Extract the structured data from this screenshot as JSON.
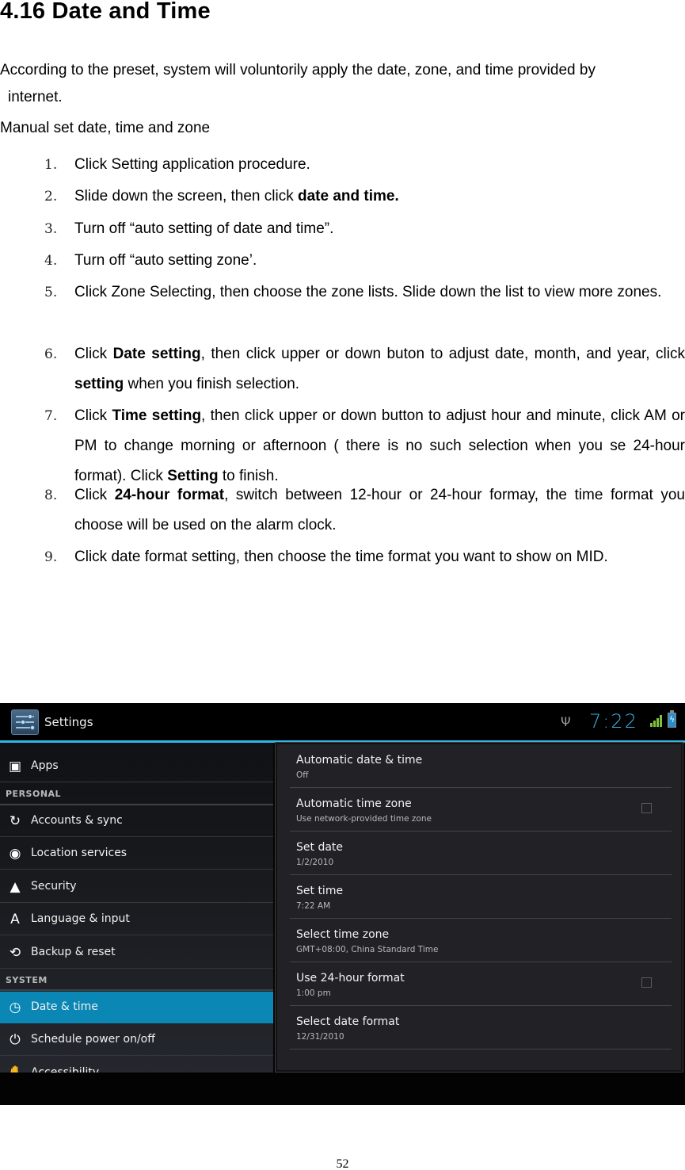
{
  "document": {
    "heading": "4.16 Date and Time",
    "intro_line1": "According to the preset, system will voluntorily apply the date, zone, and time provided by",
    "intro_line2": "internet.",
    "subheading": "Manual set date, time and zone",
    "steps": [
      {
        "num": "1.",
        "parts": [
          {
            "text": "Click Setting application procedure."
          }
        ]
      },
      {
        "num": "2.",
        "parts": [
          {
            "text": "Slide down the screen, then click "
          },
          {
            "text": "date and time.",
            "bold": true
          }
        ]
      },
      {
        "num": "3.",
        "parts": [
          {
            "text": "Turn off “auto setting of date and time”."
          }
        ]
      },
      {
        "num": "4.",
        "parts": [
          {
            "text": "Turn off “auto setting zone’."
          }
        ]
      },
      {
        "num": "5.",
        "parts": [
          {
            "text": "Click Zone Selecting, then choose the zone lists. Slide down the list to view more zones."
          }
        ]
      },
      {
        "num": "6.",
        "parts": [
          {
            "text": "Click "
          },
          {
            "text": "Date setting",
            "bold": true
          },
          {
            "text": ", then click upper or down buton to adjust date, month, and year, click "
          },
          {
            "text": "setting",
            "bold": true
          },
          {
            "text": " when you finish selection."
          }
        ]
      },
      {
        "num": "7.",
        "parts": [
          {
            "text": "Click "
          },
          {
            "text": "Time setting",
            "bold": true
          },
          {
            "text": ", then click upper or down button to adjust hour and minute, click AM or PM to change morning or afternoon ( there is no such selection when you se 24-hour format). Click "
          },
          {
            "text": "Setting",
            "bold": true
          },
          {
            "text": " to finish."
          }
        ]
      },
      {
        "num": "8.",
        "parts": [
          {
            "text": "Click "
          },
          {
            "text": "24-hour format",
            "bold": true
          },
          {
            "text": ", switch between 12-hour or 24-hour formay, the time format you choose will be used on the alarm clock."
          }
        ]
      },
      {
        "num": "9.",
        "parts": [
          {
            "text": "Click date format setting, then choose the time format you want to show on MID."
          }
        ]
      }
    ],
    "page_number": "52"
  },
  "screenshot": {
    "action_bar": {
      "app_icon": "settings-sliders-icon",
      "title": "Settings",
      "status": {
        "usb_icon": "Ψ",
        "clock": "7:22",
        "signal_icon": "signal-bars-icon",
        "battery_icon": "battery-charging-icon",
        "battery_glyph": "ϟ"
      }
    },
    "colors": {
      "accent": "#33b5e5",
      "selected_item": "#0a87b4",
      "action_bar_bg": "#000000",
      "pane_bg": "#222226",
      "signal": "#7ec23a"
    },
    "left_pane": {
      "apps": {
        "label": "Apps",
        "icon": "apps-icon",
        "glyph": "▣"
      },
      "personal_header": "PERSONAL",
      "personal_items": [
        {
          "label": "Accounts & sync",
          "icon": "sync-icon",
          "glyph": "↻"
        },
        {
          "label": "Location services",
          "icon": "location-icon",
          "glyph": "◉"
        },
        {
          "label": "Security",
          "icon": "lock-icon",
          "glyph": "▲"
        },
        {
          "label": "Language & input",
          "icon": "language-icon",
          "glyph": "A"
        },
        {
          "label": "Backup & reset",
          "icon": "backup-icon",
          "glyph": "⟲"
        }
      ],
      "system_header": "SYSTEM",
      "system_items": [
        {
          "label": "Date & time",
          "icon": "clock-icon",
          "glyph": "◷",
          "selected": true
        },
        {
          "label": "Schedule power on/off",
          "icon": "power-schedule-icon",
          "glyph": "⏻"
        },
        {
          "label": "Accessibility",
          "icon": "hand-icon",
          "glyph": "✋"
        }
      ]
    },
    "right_pane": {
      "items": [
        {
          "title": "Automatic date & time",
          "summary": "Off",
          "checkbox": null
        },
        {
          "title": "Automatic time zone",
          "summary": "Use network-provided time zone",
          "checkbox": false
        },
        {
          "title": "Set date",
          "summary": "1/2/2010",
          "checkbox": null
        },
        {
          "title": "Set time",
          "summary": "7:22 AM",
          "checkbox": null
        },
        {
          "title": "Select time zone",
          "summary": "GMT+08:00, China Standard Time",
          "checkbox": null
        },
        {
          "title": "Use 24-hour format",
          "summary": "1:00 pm",
          "checkbox": false
        },
        {
          "title": "Select date format",
          "summary": "12/31/2010",
          "checkbox": null
        }
      ]
    }
  }
}
